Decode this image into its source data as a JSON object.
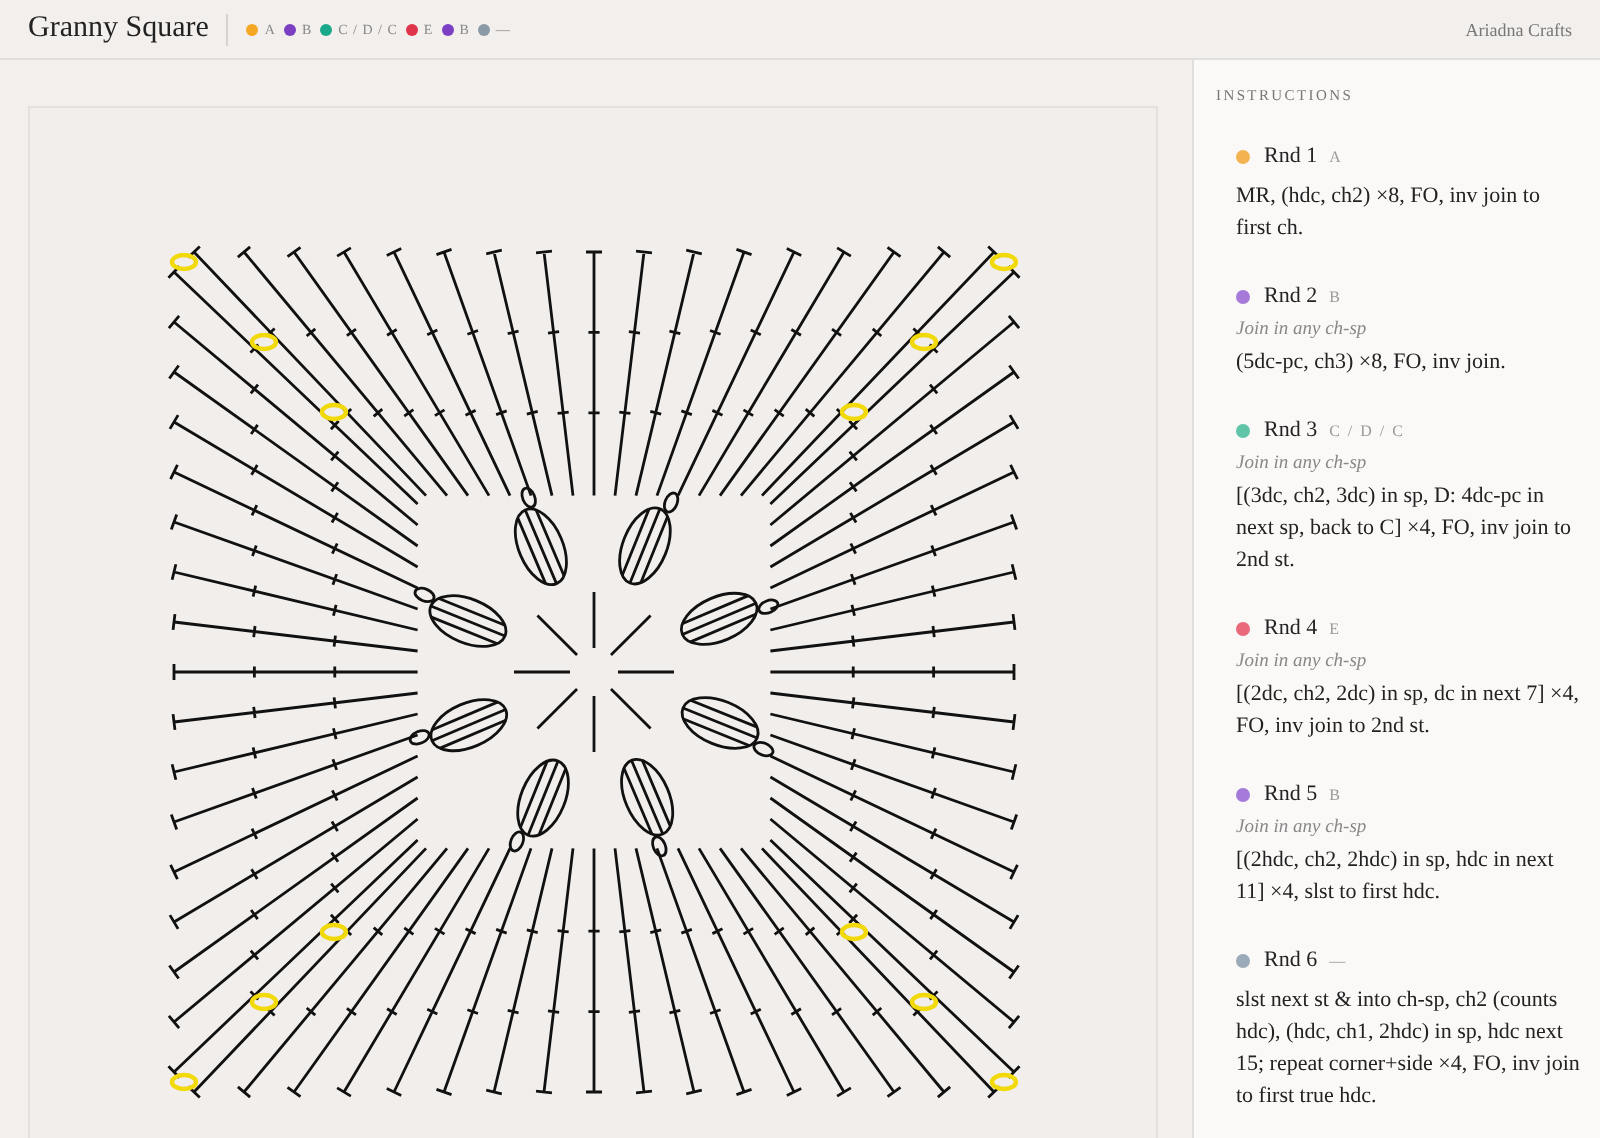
{
  "header": {
    "title": "Granny Square",
    "legend": [
      {
        "label": "A",
        "color": "#f5a623"
      },
      {
        "label": "B",
        "color": "#7b3fc4"
      },
      {
        "label": "C / D / C",
        "color": "#1aa88a"
      },
      {
        "label": "E",
        "color": "#e0344a"
      },
      {
        "label": "B",
        "color": "#7b3fc4"
      },
      {
        "label": "—",
        "color": "#8a9aa6"
      }
    ],
    "author": "Ariadna Crafts"
  },
  "instructions": {
    "heading": "INSTRUCTIONS",
    "rounds": [
      {
        "name": "Rnd 1",
        "colors": "A",
        "color": "#f2b350",
        "text": "MR, (hdc, ch2) ×8, FO, inv join to first ch."
      },
      {
        "name": "Rnd 2",
        "colors": "B",
        "color": "#a67ad8",
        "note": "Join in any ch-sp",
        "text": "(5dc-pc, ch3) ×8, FO, inv join."
      },
      {
        "name": "Rnd 3",
        "colors": "C / D / C",
        "color": "#5fc4a8",
        "note": "Join in any ch-sp",
        "text": "[(3dc, ch2, 3dc) in sp, D: 4dc-pc in next sp, back to C] ×4, FO, inv join to 2nd st."
      },
      {
        "name": "Rnd 4",
        "colors": "E",
        "color": "#ea6a7a",
        "note": "Join in any ch-sp",
        "text": "[(2dc, ch2, 2dc) in sp, dc in next 7] ×4, FO, inv join to 2nd st."
      },
      {
        "name": "Rnd 5",
        "colors": "B",
        "color": "#a67ad8",
        "note": "Join in any ch-sp",
        "text": "[(2hdc, ch2, 2hdc) in sp, hdc in next 11] ×4, slst to first hdc."
      },
      {
        "name": "Rnd 6",
        "colors": "—",
        "color": "#9aaab8",
        "text": "slst next st & into ch-sp, ch2 (counts hdc), (hdc, ch1, 2hdc) in sp, hdc next 15; repeat corner+side ×4, FO, inv join to first true hdc."
      }
    ]
  }
}
